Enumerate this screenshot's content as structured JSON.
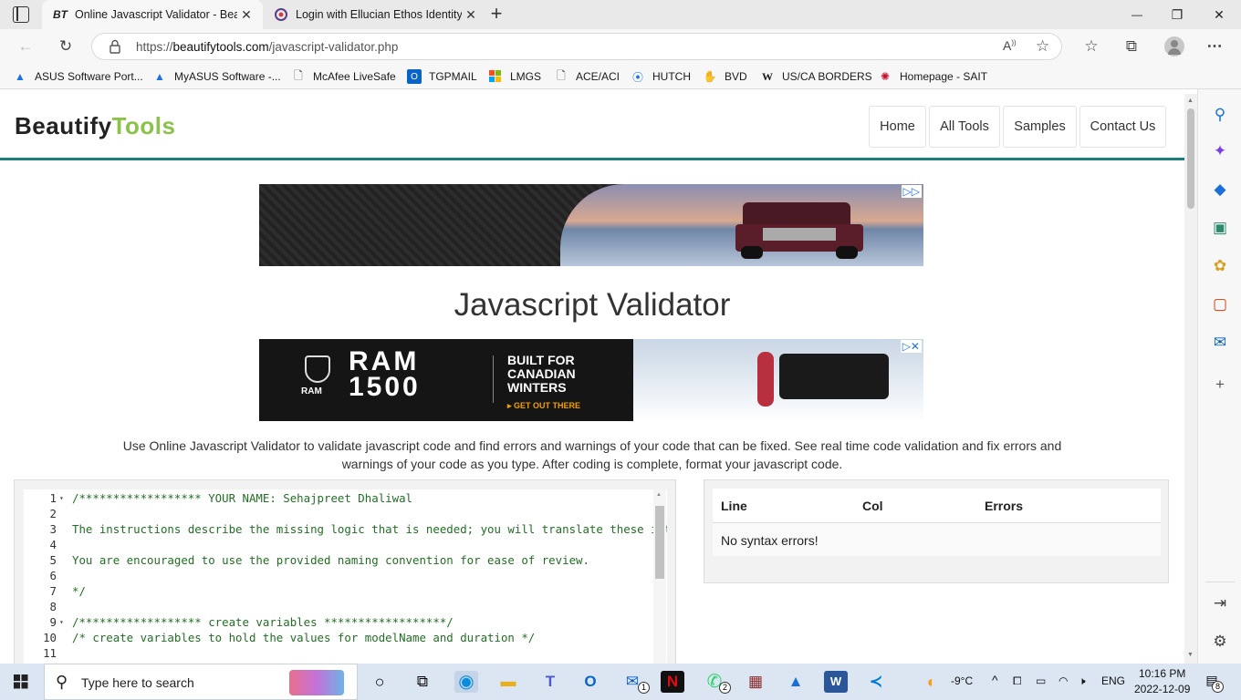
{
  "browser": {
    "tabs": [
      {
        "favicon": "BT",
        "title": "Online Javascript Validator - Beautify",
        "close": "✕"
      },
      {
        "favicon": "ethos-icon",
        "title": "Login with Ellucian Ethos Identity",
        "close": "✕"
      }
    ],
    "new_tab": "+",
    "url_scheme": "https://",
    "url_host": "beautifytools.com",
    "url_path": "/javascript-validator.php",
    "window_controls": {
      "minimize": "—",
      "restore": "❐",
      "close": "✕"
    }
  },
  "favorites": [
    {
      "icon": "asus-icon",
      "label": "ASUS Software Port..."
    },
    {
      "icon": "myasus-icon",
      "label": "MyASUS Software -..."
    },
    {
      "icon": "page-icon",
      "label": "McAfee LiveSafe"
    },
    {
      "icon": "outlook-icon",
      "label": "TGPMAIL"
    },
    {
      "icon": "windows-icon",
      "label": "LMGS"
    },
    {
      "icon": "page-icon",
      "label": "ACE/ACI"
    },
    {
      "icon": "location-icon",
      "label": "HUTCH"
    },
    {
      "icon": "hand-icon",
      "label": "BVD"
    },
    {
      "icon": "w-icon",
      "label": "US/CA BORDERS"
    },
    {
      "icon": "sait-icon",
      "label": "Homepage - SAIT"
    }
  ],
  "site": {
    "logo_part1": "Beautify",
    "logo_part2": "Tools",
    "nav": [
      "Home",
      "All Tools",
      "Samples",
      "Contact Us"
    ],
    "ad1": {
      "badge": "▷▷"
    },
    "ad2": {
      "brand": "RAM",
      "model_line1": "RAM",
      "model_line2": "1500",
      "tagline": "BUILT FOR CANADIAN WINTERS",
      "cta": "▸ GET OUT THERE",
      "badge": "▷✕"
    },
    "title": "Javascript Validator",
    "description": "Use Online Javascript Validator to validate javascript code and find errors and warnings of your code that can be fixed. See real time code validation and fix errors and warnings of your code as you type. After coding is complete, format your javascript code."
  },
  "editor": {
    "lines": [
      {
        "n": "1",
        "fold": "▾",
        "text": "/****************** YOUR NAME: Sehajpreet Dhaliwal"
      },
      {
        "n": "2",
        "fold": "",
        "text": ""
      },
      {
        "n": "3",
        "fold": "",
        "text": "The instructions describe the missing logic that is needed; you will translate these into JavaScript"
      },
      {
        "n": "4",
        "fold": "",
        "text": ""
      },
      {
        "n": "5",
        "fold": "",
        "text": "You are encouraged to use the provided naming convention for ease of review."
      },
      {
        "n": "6",
        "fold": "",
        "text": ""
      },
      {
        "n": "7",
        "fold": "",
        "text": "*/"
      },
      {
        "n": "8",
        "fold": "",
        "text": ""
      },
      {
        "n": "9",
        "fold": "▾",
        "text": "/****************** create variables ******************/"
      },
      {
        "n": "10",
        "fold": "",
        "text": "/* create variables to hold the values for modelName and duration */"
      },
      {
        "n": "11",
        "fold": "",
        "text": ""
      }
    ]
  },
  "results": {
    "headers": [
      "Line",
      "Col",
      "Errors"
    ],
    "message": "No syntax errors!"
  },
  "taskbar": {
    "search_placeholder": "Type here to search",
    "weather": "-9°C",
    "lang": "ENG",
    "time": "10:16 PM",
    "date": "2022-12-09",
    "notif_count": "8",
    "mail_badge": "1",
    "whatsapp_badge": "2"
  }
}
